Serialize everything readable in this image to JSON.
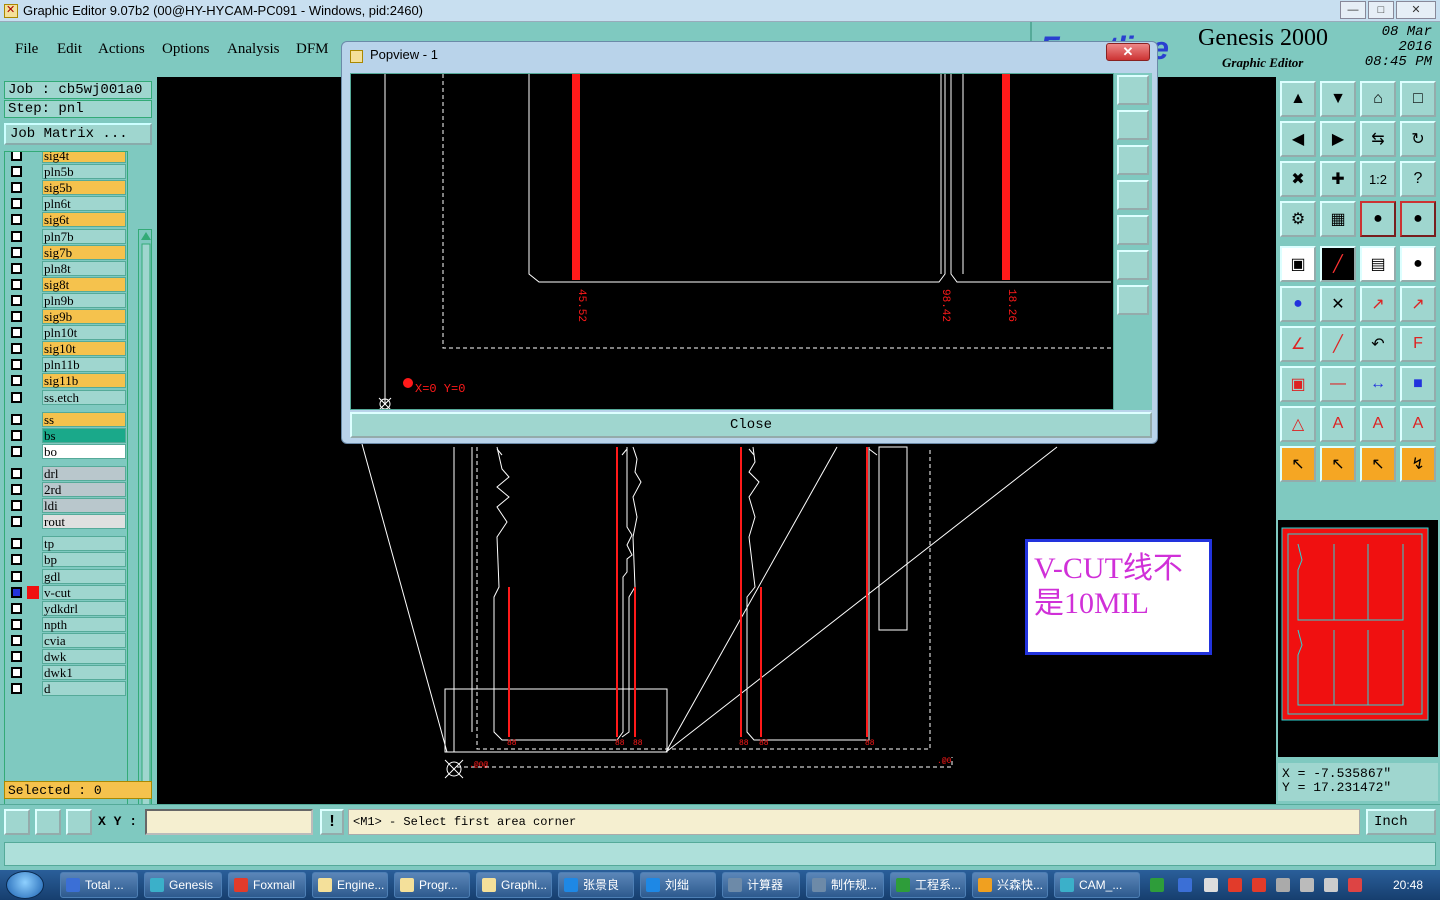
{
  "window": {
    "title": "Graphic Editor 9.07b2 (00@HY-HYCAM-PC091 - Windows, pid:2460)",
    "min": "—",
    "max": "□",
    "close": "✕"
  },
  "menu": {
    "file": "File",
    "edit": "Edit",
    "actions": "Actions",
    "options": "Options",
    "analysis": "Analysis",
    "dfm": "DFM"
  },
  "brand": {
    "logo": "Frontline",
    "product": "Genesis 2000",
    "subtitle": "Graphic Editor",
    "date": "08 Mar 2016",
    "time": "08:45 PM"
  },
  "job": {
    "job": "Job : cb5wj001a0",
    "step": "Step: pnl",
    "matrix": "Job Matrix ..."
  },
  "layers": [
    {
      "name": "sig4t",
      "color": "#f5c24d",
      "checked": false
    },
    {
      "name": "pln5b",
      "color": "#9fd6cf",
      "checked": false
    },
    {
      "name": "sig5b",
      "color": "#f5c24d",
      "checked": false
    },
    {
      "name": "pln6t",
      "color": "#9fd6cf",
      "checked": false
    },
    {
      "name": "sig6t",
      "color": "#f5c24d",
      "checked": false
    },
    {
      "name": "pln7b",
      "color": "#9fd6cf",
      "checked": false
    },
    {
      "name": "sig7b",
      "color": "#f5c24d",
      "checked": false
    },
    {
      "name": "pln8t",
      "color": "#9fd6cf",
      "checked": false
    },
    {
      "name": "sig8t",
      "color": "#f5c24d",
      "checked": false
    },
    {
      "name": "pln9b",
      "color": "#9fd6cf",
      "checked": false
    },
    {
      "name": "sig9b",
      "color": "#f5c24d",
      "checked": false
    },
    {
      "name": "pln10t",
      "color": "#9fd6cf",
      "checked": false
    },
    {
      "name": "sig10t",
      "color": "#f5c24d",
      "checked": false
    },
    {
      "name": "pln11b",
      "color": "#9fd6cf",
      "checked": false
    },
    {
      "name": "sig11b",
      "color": "#f5c24d",
      "checked": false
    },
    {
      "name": "ss.etch",
      "color": "#9fd6cf",
      "checked": false
    },
    {
      "name": "ss",
      "color": "#f5c24d",
      "checked": false
    },
    {
      "name": "bs",
      "color": "#1aa98a",
      "checked": false
    },
    {
      "name": "bo",
      "color": "#ffffff",
      "checked": false
    },
    {
      "name": "drl",
      "color": "#b9c7cc",
      "checked": false
    },
    {
      "name": "2rd",
      "color": "#b9c7cc",
      "checked": false
    },
    {
      "name": "ldi",
      "color": "#b9c7cc",
      "checked": false
    },
    {
      "name": "rout",
      "color": "#e0e0e0",
      "checked": false
    },
    {
      "name": "tp",
      "color": "#9fd6cf",
      "checked": false
    },
    {
      "name": "bp",
      "color": "#9fd6cf",
      "checked": false
    },
    {
      "name": "gdl",
      "color": "#9fd6cf",
      "checked": false
    },
    {
      "name": "v-cut",
      "color": "#9fd6cf",
      "checked": true
    },
    {
      "name": "ydkdrl",
      "color": "#9fd6cf",
      "checked": false
    },
    {
      "name": "npth",
      "color": "#9fd6cf",
      "checked": false
    },
    {
      "name": "cvia",
      "color": "#9fd6cf",
      "checked": false
    },
    {
      "name": "dwk",
      "color": "#9fd6cf",
      "checked": false
    },
    {
      "name": "dwk1",
      "color": "#9fd6cf",
      "checked": false
    },
    {
      "name": "d",
      "color": "#9fd6cf",
      "checked": false
    }
  ],
  "selected": "Selected : 0",
  "popview": {
    "title": "Popview - 1",
    "close_label": "Close",
    "dims": [
      "45.52",
      "98.42",
      "18.26"
    ],
    "origin": "X=0 Y=0"
  },
  "note": "V-CUT线不是10MIL",
  "coords": {
    "x": "X = -7.535867\"",
    "y": "Y = 17.231472\""
  },
  "status": {
    "xy_label": "X Y :",
    "excl": "!",
    "prompt": "<M1> - Select first area corner",
    "unit": "Inch"
  },
  "taskbar": {
    "items": [
      {
        "label": "Total ...",
        "color": "#3b6fd6"
      },
      {
        "label": "Genesis",
        "color": "#3bb0c9"
      },
      {
        "label": "Foxmail",
        "color": "#e23b2a"
      },
      {
        "label": "Engine...",
        "color": "#f4e09a"
      },
      {
        "label": "Progr...",
        "color": "#f4e09a"
      },
      {
        "label": "Graphi...",
        "color": "#f4e09a"
      },
      {
        "label": "张景良",
        "color": "#1e88e5"
      },
      {
        "label": "刘绌",
        "color": "#1e88e5"
      },
      {
        "label": "计算器",
        "color": "#6d8aa8"
      },
      {
        "label": "制作规...",
        "color": "#6d8aa8"
      },
      {
        "label": "工程系...",
        "color": "#2e9d3a"
      },
      {
        "label": "兴森快...",
        "color": "#f0a020"
      },
      {
        "label": "CAM_...",
        "color": "#3bb0c9"
      }
    ],
    "clock": "20:48"
  }
}
